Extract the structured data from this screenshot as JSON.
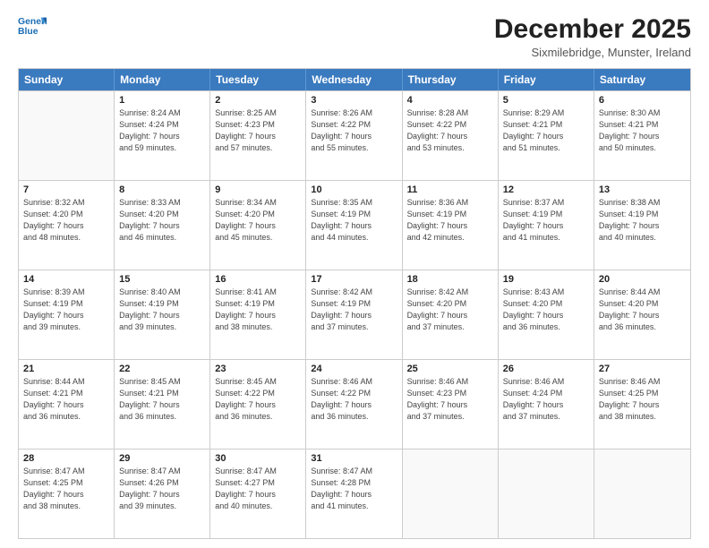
{
  "header": {
    "logo_line1": "General",
    "logo_line2": "Blue",
    "main_title": "December 2025",
    "subtitle": "Sixmilebridge, Munster, Ireland"
  },
  "weekdays": [
    "Sunday",
    "Monday",
    "Tuesday",
    "Wednesday",
    "Thursday",
    "Friday",
    "Saturday"
  ],
  "weeks": [
    [
      {
        "day": "",
        "info": ""
      },
      {
        "day": "1",
        "info": "Sunrise: 8:24 AM\nSunset: 4:24 PM\nDaylight: 7 hours\nand 59 minutes."
      },
      {
        "day": "2",
        "info": "Sunrise: 8:25 AM\nSunset: 4:23 PM\nDaylight: 7 hours\nand 57 minutes."
      },
      {
        "day": "3",
        "info": "Sunrise: 8:26 AM\nSunset: 4:22 PM\nDaylight: 7 hours\nand 55 minutes."
      },
      {
        "day": "4",
        "info": "Sunrise: 8:28 AM\nSunset: 4:22 PM\nDaylight: 7 hours\nand 53 minutes."
      },
      {
        "day": "5",
        "info": "Sunrise: 8:29 AM\nSunset: 4:21 PM\nDaylight: 7 hours\nand 51 minutes."
      },
      {
        "day": "6",
        "info": "Sunrise: 8:30 AM\nSunset: 4:21 PM\nDaylight: 7 hours\nand 50 minutes."
      }
    ],
    [
      {
        "day": "7",
        "info": "Sunrise: 8:32 AM\nSunset: 4:20 PM\nDaylight: 7 hours\nand 48 minutes."
      },
      {
        "day": "8",
        "info": "Sunrise: 8:33 AM\nSunset: 4:20 PM\nDaylight: 7 hours\nand 46 minutes."
      },
      {
        "day": "9",
        "info": "Sunrise: 8:34 AM\nSunset: 4:20 PM\nDaylight: 7 hours\nand 45 minutes."
      },
      {
        "day": "10",
        "info": "Sunrise: 8:35 AM\nSunset: 4:19 PM\nDaylight: 7 hours\nand 44 minutes."
      },
      {
        "day": "11",
        "info": "Sunrise: 8:36 AM\nSunset: 4:19 PM\nDaylight: 7 hours\nand 42 minutes."
      },
      {
        "day": "12",
        "info": "Sunrise: 8:37 AM\nSunset: 4:19 PM\nDaylight: 7 hours\nand 41 minutes."
      },
      {
        "day": "13",
        "info": "Sunrise: 8:38 AM\nSunset: 4:19 PM\nDaylight: 7 hours\nand 40 minutes."
      }
    ],
    [
      {
        "day": "14",
        "info": "Sunrise: 8:39 AM\nSunset: 4:19 PM\nDaylight: 7 hours\nand 39 minutes."
      },
      {
        "day": "15",
        "info": "Sunrise: 8:40 AM\nSunset: 4:19 PM\nDaylight: 7 hours\nand 39 minutes."
      },
      {
        "day": "16",
        "info": "Sunrise: 8:41 AM\nSunset: 4:19 PM\nDaylight: 7 hours\nand 38 minutes."
      },
      {
        "day": "17",
        "info": "Sunrise: 8:42 AM\nSunset: 4:19 PM\nDaylight: 7 hours\nand 37 minutes."
      },
      {
        "day": "18",
        "info": "Sunrise: 8:42 AM\nSunset: 4:20 PM\nDaylight: 7 hours\nand 37 minutes."
      },
      {
        "day": "19",
        "info": "Sunrise: 8:43 AM\nSunset: 4:20 PM\nDaylight: 7 hours\nand 36 minutes."
      },
      {
        "day": "20",
        "info": "Sunrise: 8:44 AM\nSunset: 4:20 PM\nDaylight: 7 hours\nand 36 minutes."
      }
    ],
    [
      {
        "day": "21",
        "info": "Sunrise: 8:44 AM\nSunset: 4:21 PM\nDaylight: 7 hours\nand 36 minutes."
      },
      {
        "day": "22",
        "info": "Sunrise: 8:45 AM\nSunset: 4:21 PM\nDaylight: 7 hours\nand 36 minutes."
      },
      {
        "day": "23",
        "info": "Sunrise: 8:45 AM\nSunset: 4:22 PM\nDaylight: 7 hours\nand 36 minutes."
      },
      {
        "day": "24",
        "info": "Sunrise: 8:46 AM\nSunset: 4:22 PM\nDaylight: 7 hours\nand 36 minutes."
      },
      {
        "day": "25",
        "info": "Sunrise: 8:46 AM\nSunset: 4:23 PM\nDaylight: 7 hours\nand 37 minutes."
      },
      {
        "day": "26",
        "info": "Sunrise: 8:46 AM\nSunset: 4:24 PM\nDaylight: 7 hours\nand 37 minutes."
      },
      {
        "day": "27",
        "info": "Sunrise: 8:46 AM\nSunset: 4:25 PM\nDaylight: 7 hours\nand 38 minutes."
      }
    ],
    [
      {
        "day": "28",
        "info": "Sunrise: 8:47 AM\nSunset: 4:25 PM\nDaylight: 7 hours\nand 38 minutes."
      },
      {
        "day": "29",
        "info": "Sunrise: 8:47 AM\nSunset: 4:26 PM\nDaylight: 7 hours\nand 39 minutes."
      },
      {
        "day": "30",
        "info": "Sunrise: 8:47 AM\nSunset: 4:27 PM\nDaylight: 7 hours\nand 40 minutes."
      },
      {
        "day": "31",
        "info": "Sunrise: 8:47 AM\nSunset: 4:28 PM\nDaylight: 7 hours\nand 41 minutes."
      },
      {
        "day": "",
        "info": ""
      },
      {
        "day": "",
        "info": ""
      },
      {
        "day": "",
        "info": ""
      }
    ]
  ]
}
